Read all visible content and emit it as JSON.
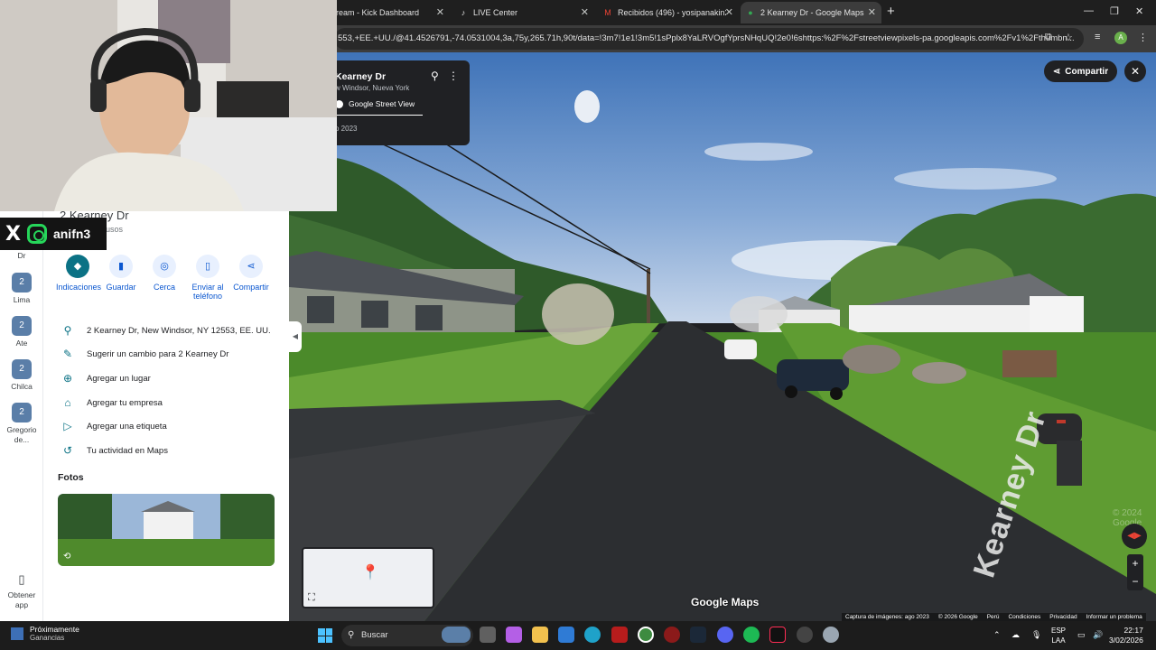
{
  "browser": {
    "tabs": [
      {
        "label": "ream - Kick Dashboard",
        "active": false
      },
      {
        "label": "LIVE Center",
        "active": false
      },
      {
        "label": "Recibidos (496) - yosipanakin2@",
        "active": false
      },
      {
        "label": "2 Kearney Dr - Google Maps",
        "active": true
      }
    ],
    "url": "553,+EE.+UU./@41.4526791,-74.0531004,3a,75y,265.71h,90t/data=!3m7!1e1!3m5!1sPplx8YaLRVOgfYprsNHqUQ!2e0!6shttps:%2F%2Fstreetviewpixels-pa.googleapis.com%2Fv1%2Fthumbn...",
    "profile_initial": "A"
  },
  "streetview": {
    "card_title": "Kearney Dr",
    "card_subtitle": "w Windsor, Nueva York",
    "card_source": "Google Street View",
    "card_date": "o 2023",
    "share_label": "Compartir",
    "street_label": "Kearney Dr",
    "watermark": "© 2024 Google",
    "logo": "Google Maps",
    "attribution": [
      "Captura de imágenes: ago 2023",
      "© 2026 Google",
      "Perú",
      "Condiciones",
      "Privacidad",
      "Informar un problema"
    ],
    "zoom_in": "+",
    "zoom_out": "−"
  },
  "rail": {
    "items": [
      {
        "label": "Dr",
        "badge": ""
      },
      {
        "label": "Lima",
        "badge": "2"
      },
      {
        "label": "Ate",
        "badge": "2"
      },
      {
        "label": "Chilca",
        "badge": "2"
      },
      {
        "label": "Gregorio de...",
        "badge": "2"
      }
    ],
    "get_app": "Obtener app"
  },
  "place": {
    "title": "2 Kearney Dr",
    "subtitle": "usos",
    "actions": [
      {
        "label": "Indicaciones",
        "icon": "directions-icon"
      },
      {
        "label": "Guardar",
        "icon": "bookmark-icon"
      },
      {
        "label": "Cerca",
        "icon": "nearby-icon"
      },
      {
        "label": "Enviar al teléfono",
        "icon": "phone-icon"
      },
      {
        "label": "Compartir",
        "icon": "share-icon"
      }
    ],
    "info": [
      {
        "text": "2 Kearney Dr, New Windsor, NY 12553, EE. UU.",
        "icon": "pin-icon"
      },
      {
        "text": "Sugerir un cambio para 2 Kearney Dr",
        "icon": "pencil-icon"
      },
      {
        "text": "Agregar un lugar",
        "icon": "add-place-icon"
      },
      {
        "text": "Agregar tu empresa",
        "icon": "store-icon"
      },
      {
        "text": "Agregar una etiqueta",
        "icon": "label-icon"
      },
      {
        "text": "Tu actividad en Maps",
        "icon": "history-icon"
      }
    ],
    "photos_heading": "Fotos"
  },
  "overlay": {
    "social_handle": "anifn3"
  },
  "taskbar": {
    "news_title": "Próximamente",
    "news_sub": "Ganancias",
    "search_label": "Buscar",
    "lang_top": "ESP",
    "lang_bottom": "LAA",
    "time": "22:17",
    "date": "3/02/2026"
  },
  "colors": {
    "accent": "#0b7285",
    "link_blue": "#0b57d0",
    "panel_bg": "#ffffff",
    "card_bg": "#202124"
  }
}
